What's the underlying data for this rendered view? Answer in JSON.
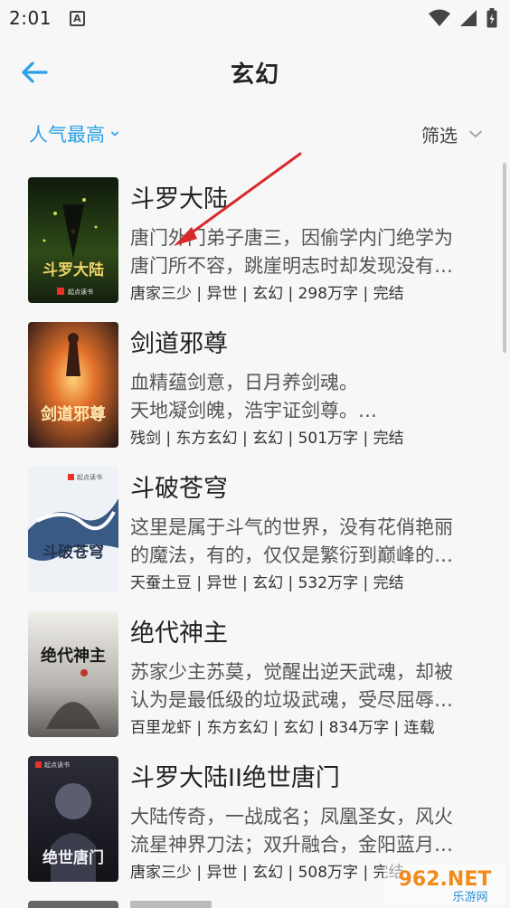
{
  "status_bar": {
    "time": "2:01",
    "a_icon": "A"
  },
  "header": {
    "title": "玄幻"
  },
  "filters": {
    "sort_label": "人气最高",
    "filter_label": "筛选"
  },
  "books": [
    {
      "title": "斗罗大陆",
      "desc_line1": "唐门外门弟子唐三，因偷学内门绝学为",
      "desc_line2": "唐门所不容，跳崖明志时却发现没有…",
      "meta": "唐家三少 | 异世 | 玄幻 | 298万字 | 完结",
      "cover_text": "斗罗大陆",
      "cover_badge": "起点读书",
      "cover_colors": [
        "#1a2a14",
        "#3d5a1c"
      ]
    },
    {
      "title": "剑道邪尊",
      "desc_line1": "血精蕴剑意，日月养剑魂。",
      "desc_line2": "天地凝剑魄，浩宇证剑尊。…",
      "meta": "残剑 | 东方玄幻 | 玄幻 | 501万字 | 完结",
      "cover_text": "剑道邪尊",
      "cover_badge": "",
      "cover_colors": [
        "#3a1e16",
        "#c4561f"
      ]
    },
    {
      "title": "斗破苍穹",
      "desc_line1": "这里是属于斗气的世界，没有花俏艳丽",
      "desc_line2": "的魔法，有的，仅仅是繁衍到巅峰的…",
      "meta": "天蚕土豆 | 异世 | 玄幻 | 532万字 | 完结",
      "cover_text": "斗破苍穹",
      "cover_badge": "起点读书",
      "cover_colors": [
        "#e6eef6",
        "#2f4f7a"
      ]
    },
    {
      "title": "绝代神主",
      "desc_line1": "苏家少主苏莫，觉醒出逆天武魂，却被",
      "desc_line2": "认为是最低级的垃圾武魂，受尽屈辱…",
      "meta": "百里龙虾 | 东方玄幻 | 玄幻 | 834万字 | 连载",
      "cover_text": "绝代神主",
      "cover_badge": "",
      "cover_colors": [
        "#e9e6e0",
        "#6c6a66"
      ]
    },
    {
      "title": "斗罗大陆II绝世唐门",
      "desc_line1": "大陆传奇，一战成名；凤凰圣女，风火",
      "desc_line2": "流星神界刀法；双升融合，金阳蓝月…",
      "meta": "唐家三少 | 异世 | 玄幻 | 508万字 | 完结",
      "cover_text": "绝世唐门",
      "cover_badge": "起点读书",
      "cover_colors": [
        "#1c1c24",
        "#4a4c5c"
      ]
    }
  ],
  "watermark": {
    "logo": "962.NET",
    "sub": "乐游网"
  },
  "colors": {
    "accent": "#2aa0e6",
    "arrow": "#d82a2a",
    "text": "#222222",
    "muted": "#555555"
  }
}
